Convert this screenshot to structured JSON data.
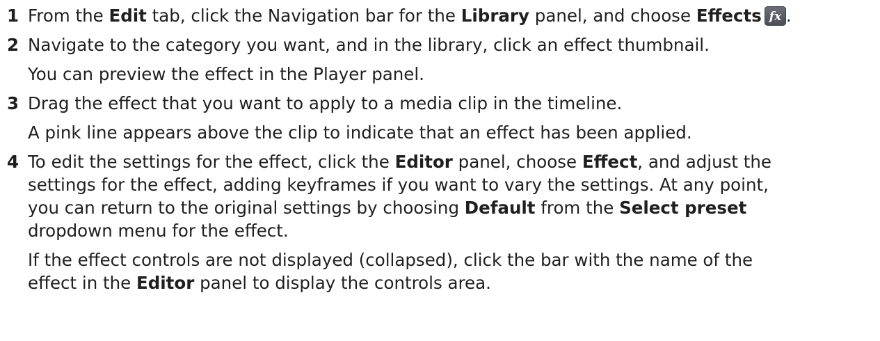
{
  "steps": [
    {
      "number": "1",
      "t1": "From the ",
      "b1": "Edit",
      "t2": " tab, click the Navigation bar for the ",
      "b2": "Library",
      "t3": " panel, and choose ",
      "b3": "Effects",
      "icon": "effects-fx-icon",
      "t4": "."
    },
    {
      "number": "2",
      "text": "Navigate to the category you want, and in the library, click an effect thumbnail.",
      "note": "You can preview the effect in the Player panel."
    },
    {
      "number": "3",
      "text": "Drag the effect that you want to apply to a media clip in the timeline.",
      "note": "A pink line appears above the clip to indicate that an effect has been applied."
    },
    {
      "number": "4",
      "l1a": "To edit the settings for the effect, click the ",
      "l1b": "Editor",
      "l1c": " panel, choose ",
      "l1d": "Effect",
      "l1e": ", and adjust the",
      "l2": "settings for the effect, adding keyframes if you want to vary the settings. At any point,",
      "l3a": "you can return to the original settings by choosing ",
      "l3b": "Default",
      "l3c": " from the ",
      "l3d": "Select preset",
      "l4": "dropdown menu for the effect.",
      "n1": "If the effect controls are not displayed (collapsed), click the bar with the name of the",
      "n2a": "effect in the ",
      "n2b": "Editor",
      "n2c": " panel to display the controls area."
    }
  ],
  "colors": {
    "text": "#1f1f1f",
    "icon_bg": "#5a5f66",
    "icon_fg": "#ffffff"
  }
}
